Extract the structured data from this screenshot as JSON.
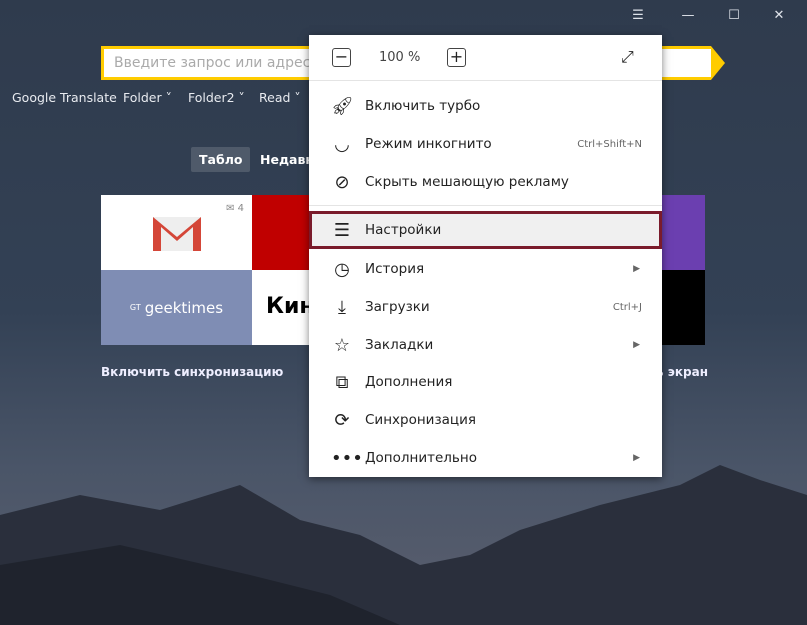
{
  "window": {
    "menu_icon": "hamburger-icon",
    "minimize": "—",
    "maximize": "☐",
    "close": "✕"
  },
  "search": {
    "placeholder": "Введите запрос или адрес"
  },
  "bookmarks": [
    {
      "label": "Google Translate"
    },
    {
      "label": "Folder ˅"
    },
    {
      "label": "Folder2 ˅"
    },
    {
      "label": "Read ˅"
    }
  ],
  "tabs": [
    {
      "label": "Табло"
    },
    {
      "label": "Недавно"
    }
  ],
  "tiles": {
    "gmail_count": "4",
    "geektimes": "geektimes",
    "kino": "Кин"
  },
  "captions": {
    "sync": "Включить синхронизацию",
    "screen": "ь экран"
  },
  "menu": {
    "zoom": {
      "minus": "−",
      "value": "100 %",
      "plus": "+",
      "fullscreen_icon": "fullscreen-icon"
    },
    "items": [
      {
        "label": "Включить турбо",
        "icon": "rocket-icon"
      },
      {
        "label": "Режим инкогнито",
        "icon": "mask-icon",
        "shortcut": "Ctrl+Shift+N"
      },
      {
        "label": "Скрыть мешающую рекламу",
        "icon": "block-icon"
      },
      {
        "label": "Настройки",
        "icon": "sliders-icon",
        "selected": true
      },
      {
        "label": "История",
        "icon": "clock-icon",
        "submenu": true
      },
      {
        "label": "Загрузки",
        "icon": "download-icon",
        "shortcut": "Ctrl+J"
      },
      {
        "label": "Закладки",
        "icon": "star-icon",
        "submenu": true
      },
      {
        "label": "Дополнения",
        "icon": "addons-icon"
      },
      {
        "label": "Синхронизация",
        "icon": "sync-icon"
      },
      {
        "label": "Дополнительно",
        "icon": "more-icon",
        "submenu": true
      }
    ]
  },
  "colors": {
    "accent": "#ffcc00",
    "selected_outline": "#7a1b2b",
    "background": "#2f3b4d"
  }
}
